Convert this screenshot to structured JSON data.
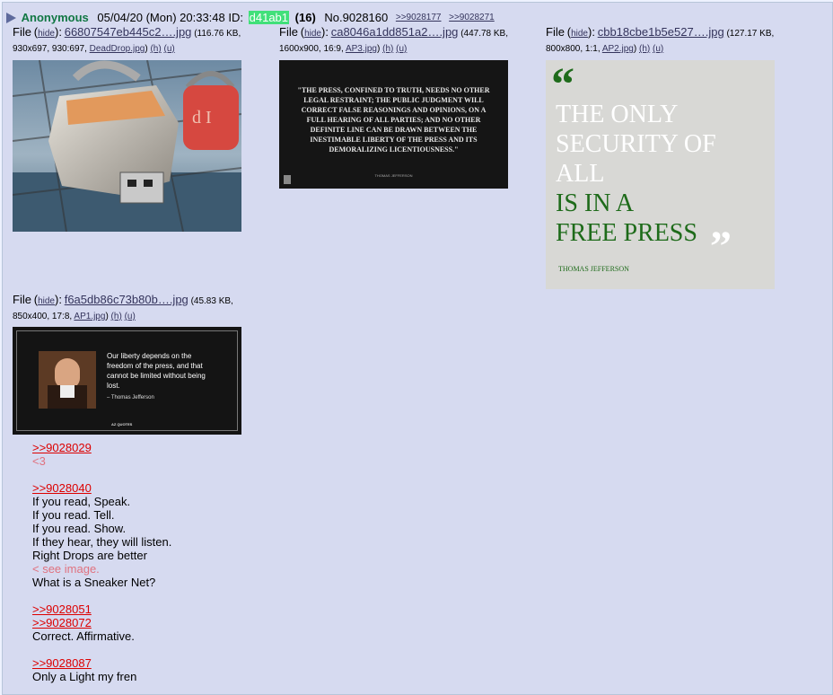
{
  "post": {
    "name": "Anonymous",
    "datetime": "05/04/20 (Mon) 20:33:48",
    "id_label": "ID:",
    "id": "d41ab1",
    "count": "(16)",
    "number": "No.9028160",
    "backlinks": [
      ">>9028177",
      ">>9028271"
    ]
  },
  "files": [
    {
      "label": "File",
      "hide": "hide",
      "name": "66807547eb445c2….jpg",
      "meta1": "(116.76 KB,",
      "meta2": "930x697, 930:697,",
      "orig": "DeadDrop.jpg",
      "h": "(h)",
      "u": "(u)"
    },
    {
      "label": "File",
      "hide": "hide",
      "name": "ca8046a1dd851a2….jpg",
      "meta1": "(447.78 KB,",
      "meta2": "1600x900, 16:9,",
      "orig": "AP3.jpg",
      "h": "(h)",
      "u": "(u)"
    },
    {
      "label": "File",
      "hide": "hide",
      "name": "cbb18cbe1b5e527….jpg",
      "meta1": "(127.17 KB,",
      "meta2": "800x800, 1:1,",
      "orig": "AP2.jpg",
      "h": "(h)",
      "u": "(u)"
    },
    {
      "label": "File",
      "hide": "hide",
      "name": "f6a5db86c73b80b….jpg",
      "meta1": "(45.83 KB,",
      "meta2": "850x400, 17:8,",
      "orig": "AP1.jpg",
      "h": "(h)",
      "u": "(u)"
    }
  ],
  "images": {
    "quote_press": "\"THE PRESS, CONFINED TO TRUTH, NEEDS NO OTHER LEGAL RESTRAINT; THE PUBLIC JUDGMENT WILL CORRECT FALSE REASONINGS AND OPINIONS, ON A FULL HEARING OF ALL PARTIES; AND NO OTHER DEFINITE LINE CAN BE DRAWN BETWEEN THE INESTIMABLE LIBERTY OF THE PRESS AND ITS DEMORALIZING LICENTIOUSNESS.\"",
    "quote_press_author": "THOMAS JEFFERSON",
    "sec_lines": [
      "THE ONLY",
      "SECURITY OF",
      "ALL"
    ],
    "sec_green": [
      "IS IN A",
      "FREE PRESS"
    ],
    "sec_author": "THOMAS JEFFERSON",
    "liberty_quote": "Our liberty depends on the freedom of the press, and that cannot be limited without being lost.",
    "liberty_author": "– Thomas Jefferson",
    "liberty_brand": "AZ QUOTES",
    "colors": {
      "green_quote": "#1e6b1a",
      "azq_bg": "#141414"
    }
  },
  "message": [
    {
      "type": "quote",
      "text": ">>9028029"
    },
    {
      "type": "green",
      "text": "<3"
    },
    {
      "type": "space"
    },
    {
      "type": "quote",
      "text": ">>9028040"
    },
    {
      "type": "text",
      "text": "If you read, Speak."
    },
    {
      "type": "text",
      "text": "If you read. Tell."
    },
    {
      "type": "text",
      "text": "If you read. Show."
    },
    {
      "type": "text",
      "text": "If they hear, they will listen."
    },
    {
      "type": "text",
      "text": "Right Drops are better"
    },
    {
      "type": "green",
      "text": "< see image."
    },
    {
      "type": "text",
      "text": "What is a Sneaker Net?"
    },
    {
      "type": "space"
    },
    {
      "type": "quote",
      "text": ">>9028051"
    },
    {
      "type": "quote",
      "text": ">>9028072"
    },
    {
      "type": "text",
      "text": "Correct. Affirmative."
    },
    {
      "type": "space"
    },
    {
      "type": "quote",
      "text": ">>9028087"
    },
    {
      "type": "text",
      "text": "Only a Light my fren"
    }
  ]
}
